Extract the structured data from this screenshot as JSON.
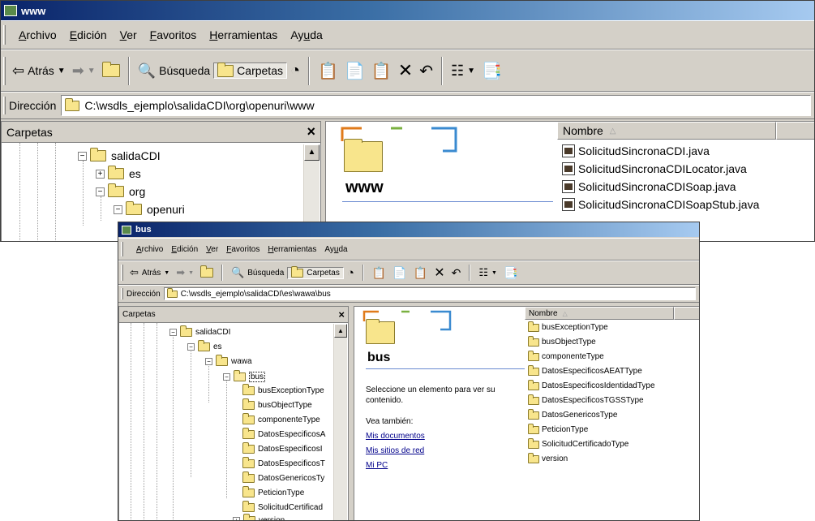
{
  "back_window": {
    "title": "www",
    "menu": [
      "Archivo",
      "Edición",
      "Ver",
      "Favoritos",
      "Herramientas",
      "Ayuda"
    ],
    "toolbar": {
      "back": "Atrás",
      "search": "Búsqueda",
      "folders": "Carpetas"
    },
    "address_label": "Dirección",
    "address": "C:\\wsdls_ejemplo\\salidaCDI\\org\\openuri\\www",
    "folders_title": "Carpetas",
    "close_glyph": "×",
    "tree": [
      "salidaCDI",
      "es",
      "org",
      "openuri"
    ],
    "folder_heading": "www",
    "column_name": "Nombre",
    "files": [
      "SolicitudSincronaCDI.java",
      "SolicitudSincronaCDILocator.java",
      "SolicitudSincronaCDISoap.java",
      "SolicitudSincronaCDISoapStub.java"
    ]
  },
  "front_window": {
    "title": "bus",
    "menu": [
      "Archivo",
      "Edición",
      "Ver",
      "Favoritos",
      "Herramientas",
      "Ayuda"
    ],
    "toolbar": {
      "back": "Atrás",
      "search": "Búsqueda",
      "folders": "Carpetas"
    },
    "address_label": "Dirección",
    "address": "C:\\wsdls_ejemplo\\salidaCDI\\es\\wawa\\bus",
    "folders_title": "Carpetas",
    "close_glyph": "×",
    "tree": [
      "salidaCDI",
      "es",
      "wawa",
      "bus",
      "busExceptionType",
      "busObjectType",
      "componenteType",
      "DatosEspecificosA",
      "DatosEspecificosI",
      "DatosEspecificosT",
      "DatosGenericosTy",
      "PeticionType",
      "SolicitudCertificad",
      "version"
    ],
    "folder_heading": "bus",
    "info_text": "Seleccione un elemento para ver su contenido.",
    "see_also": "Vea también:",
    "links": [
      "Mis documentos",
      "Mis sitios de red",
      "Mi PC"
    ],
    "column_name": "Nombre",
    "files": [
      "busExceptionType",
      "busObjectType",
      "componenteType",
      "DatosEspecificosAEATType",
      "DatosEspecificosIdentidadType",
      "DatosEspecificosTGSSType",
      "DatosGenericosType",
      "PeticionType",
      "SolicitudCertificadoType",
      "version"
    ]
  }
}
